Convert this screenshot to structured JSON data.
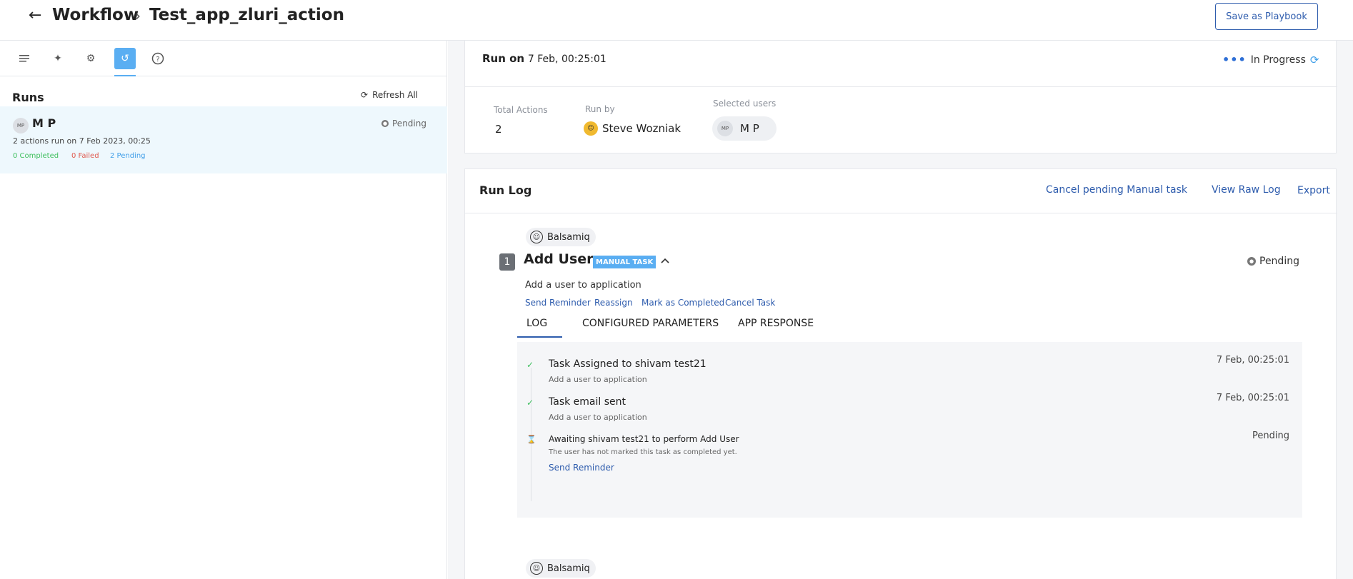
{
  "header": {
    "back_icon": "arrow-left-icon",
    "breadcrumb_root": "Workflow",
    "breadcrumb_sep": "›",
    "title": "Test_app_zluri_action",
    "save_playbook": "Save as Playbook"
  },
  "toolbar": {
    "items": [
      "list-icon",
      "sparkle-icon",
      "gears-icon",
      "history-icon",
      "help-icon"
    ],
    "active_index": 3
  },
  "runs": {
    "title": "Runs",
    "refresh_all": "Refresh All",
    "items": [
      {
        "avatar": "MP",
        "user": "M P",
        "status": "Pending",
        "description": "2 actions run on 7 Feb 2023, 00:25",
        "completed": "0 Completed",
        "failed": "0 Failed",
        "pending": "2 Pending"
      }
    ]
  },
  "summary": {
    "run_on_label": "Run on",
    "run_on_value": "7 Feb, 00:25:01",
    "status_dots": "•••",
    "status": "In Progress",
    "total_actions_label": "Total Actions",
    "total_actions": "2",
    "run_by_label": "Run by",
    "run_by_name": "Steve Wozniak",
    "selected_users_label": "Selected users",
    "selected_user_avatar": "MP",
    "selected_user_name": "M P"
  },
  "run_log": {
    "title": "Run Log",
    "actions": [
      "Cancel pending Manual task",
      "View Raw Log",
      "Export"
    ],
    "app_name": "Balsamiq",
    "step": {
      "number": "1",
      "title": "Add User",
      "badge": "MANUAL TASK",
      "status": "Pending",
      "description": "Add a user to application",
      "links": [
        "Send Reminder",
        "Reassign",
        "Mark as Completed",
        "Cancel Task"
      ],
      "tabs": [
        "LOG",
        "CONFIGURED PARAMETERS",
        "APP RESPONSE"
      ],
      "active_tab": 0,
      "entries": [
        {
          "icon": "check-icon",
          "title": "Task Assigned to shivam test21",
          "sub": "Add a user to application",
          "time": "7 Feb, 00:25:01"
        },
        {
          "icon": "check-icon",
          "title": "Task email sent",
          "sub": "Add a user to application",
          "time": "7 Feb, 00:25:01"
        },
        {
          "icon": "hourglass-icon",
          "title": "Awaiting shivam test21 to perform Add User",
          "sub": "The user has not marked this task as completed yet.",
          "time": "Pending",
          "link": "Send Reminder"
        }
      ]
    },
    "next_app_name": "Balsamiq"
  }
}
